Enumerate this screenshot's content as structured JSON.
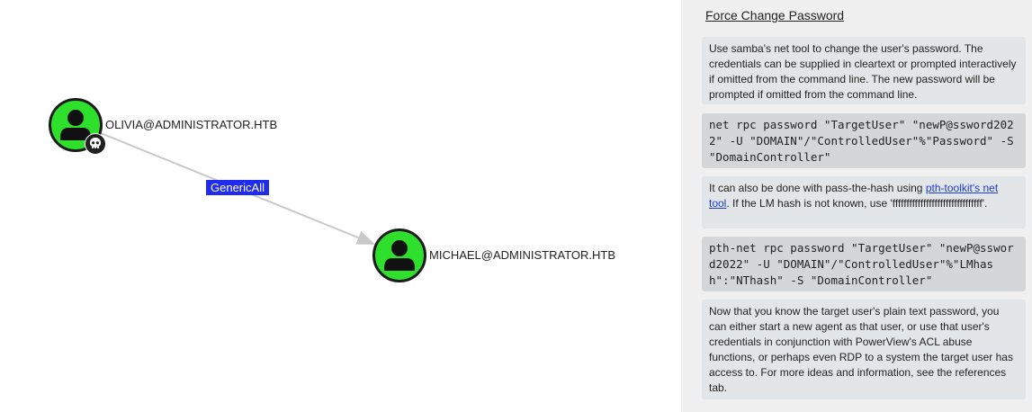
{
  "graph": {
    "nodes": [
      {
        "label": "OLIVIA@ADMINISTRATOR.HTB",
        "icon": "user-icon",
        "badge": "skull-icon",
        "color": "#2ee02b"
      },
      {
        "label": "MICHAEL@ADMINISTRATOR.HTB",
        "icon": "user-icon",
        "color": "#2ee02b"
      }
    ],
    "edge": {
      "label": "GenericAll",
      "color": "#1f2bf0"
    }
  },
  "panel": {
    "title": "Force Change Password",
    "p1": "Use samba's net tool to change the user's password. The credentials can be supplied in cleartext or prompted interactively if omitted from the command line. The new password will be prompted if omitted from the command line.",
    "code1": "net rpc password \"TargetUser\" \"newP@ssword2022\" -U \"DOMAIN\"/\"ControlledUser\"%\"Password\" -S \"DomainController\"",
    "p2_prefix": "It can also be done with pass-the-hash using ",
    "p2_link": "pth-toolkit's net tool",
    "p2_suffix": ". If the LM hash is not known, use 'ffffffffffffffffffffffffffffffff'.",
    "code2": "pth-net rpc password \"TargetUser\" \"newP@ssword2022\" -U \"DOMAIN\"/\"ControlledUser\"%\"LMhash\":\"NThash\" -S \"DomainController\"",
    "p3": "Now that you know the target user's plain text password, you can either start a new agent as that user, or use that user's credentials in conjunction with PowerView's ACL abuse functions, or perhaps even RDP to a system the target user has access to. For more ideas and information, see the references tab."
  }
}
